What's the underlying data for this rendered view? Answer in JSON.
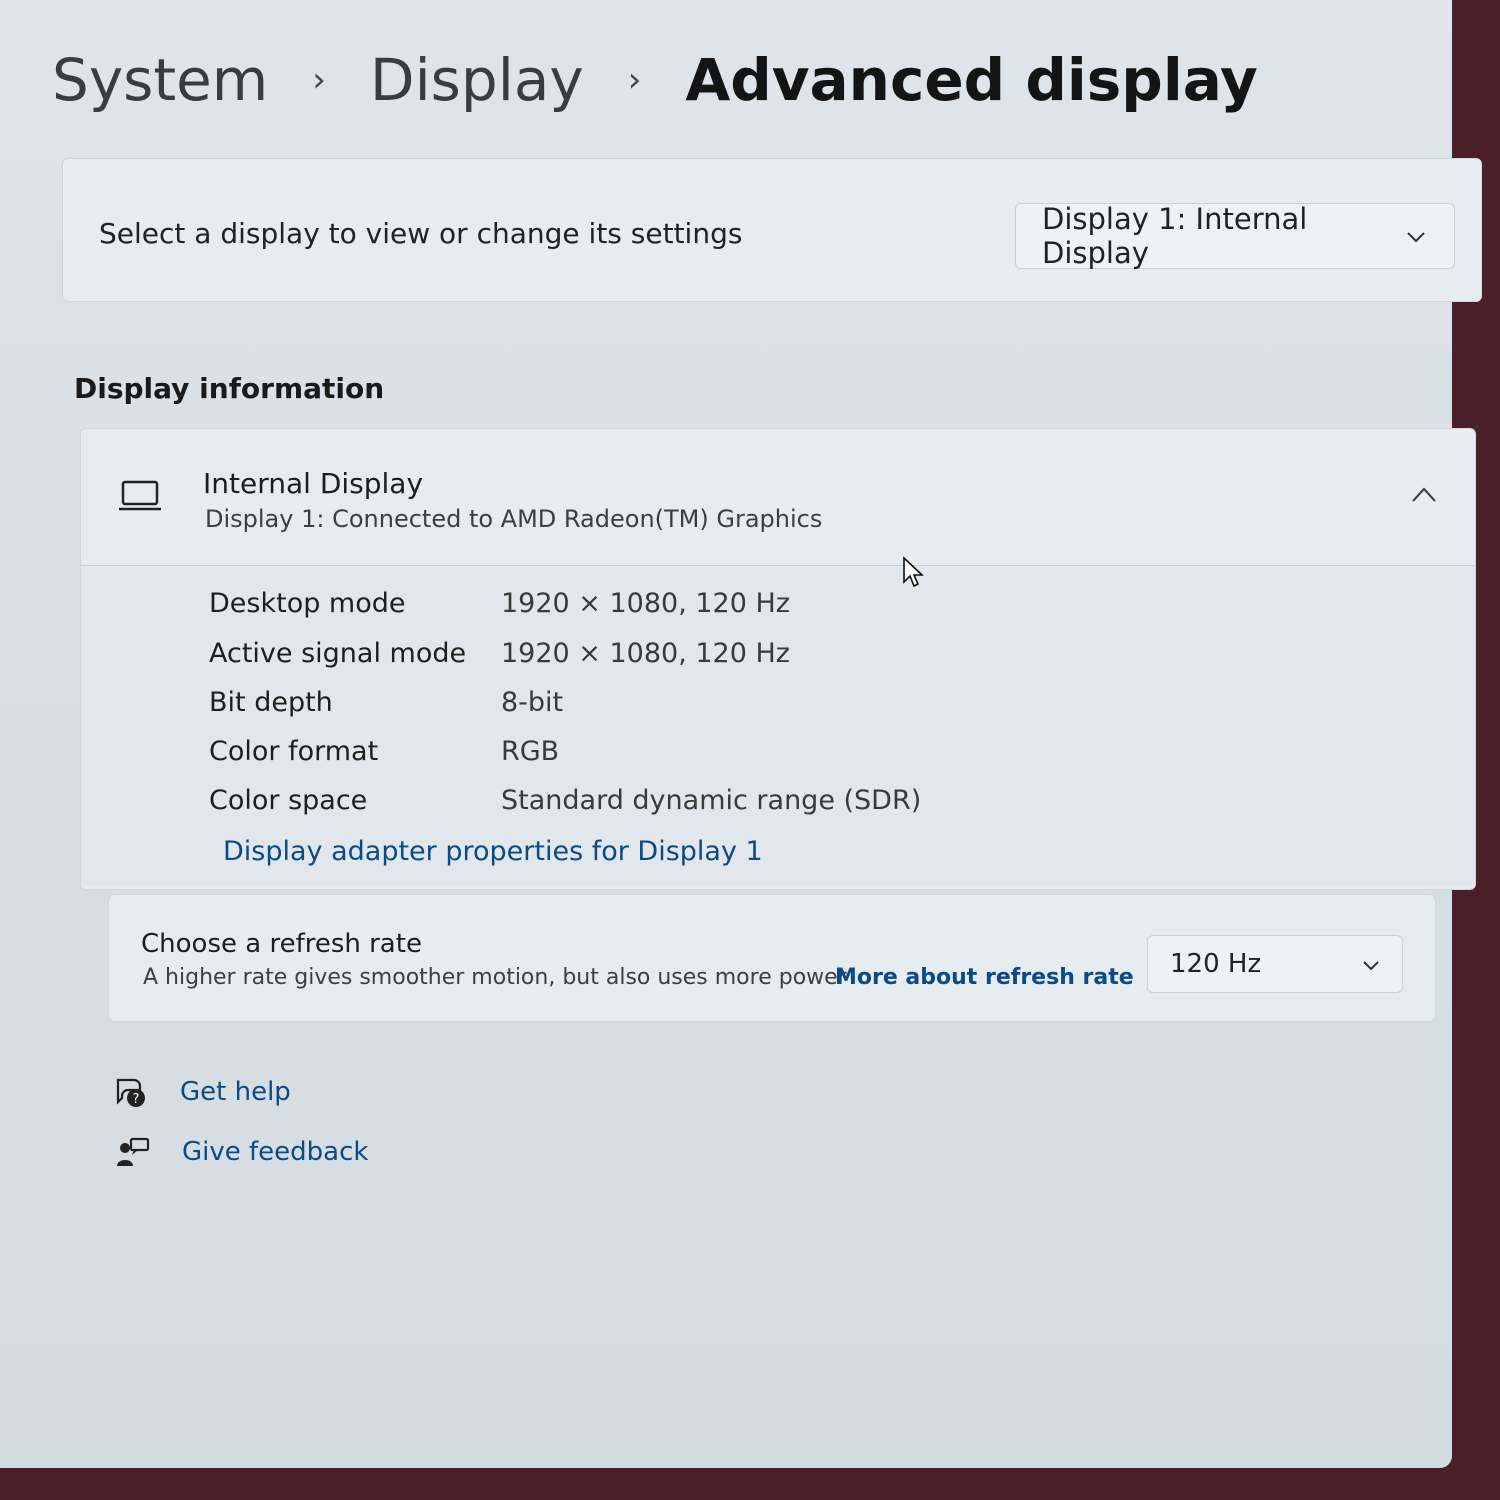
{
  "breadcrumb": {
    "system": "System",
    "sep": "›",
    "display": "Display",
    "current": "Advanced display"
  },
  "select_display": {
    "label": "Select a display to view or change its settings",
    "selected": "Display 1: Internal Display",
    "icon": "chevron-down-icon"
  },
  "display_information": {
    "title": "Display information",
    "name": "Internal Display",
    "subtitle": "Display 1: Connected to AMD Radeon(TM) Graphics",
    "icon": "laptop-icon",
    "rows": [
      {
        "label": "Desktop mode",
        "value": "1920 × 1080, 120 Hz"
      },
      {
        "label": "Active signal mode",
        "value": "1920 × 1080, 120 Hz"
      },
      {
        "label": "Bit depth",
        "value": "8-bit"
      },
      {
        "label": "Color format",
        "value": "RGB"
      },
      {
        "label": "Color space",
        "value": "Standard dynamic range (SDR)"
      }
    ],
    "adapter_link": "Display adapter properties for Display 1"
  },
  "refresh_rate": {
    "title": "Choose a refresh rate",
    "description": "A higher rate gives smoother motion, but also uses more power",
    "link": "More about refresh rate",
    "selected": "120 Hz"
  },
  "footer": {
    "get_help": "Get help",
    "give_feedback": "Give feedback"
  },
  "colors": {
    "link": "#0a4a86",
    "background": "#dfe5ea"
  }
}
